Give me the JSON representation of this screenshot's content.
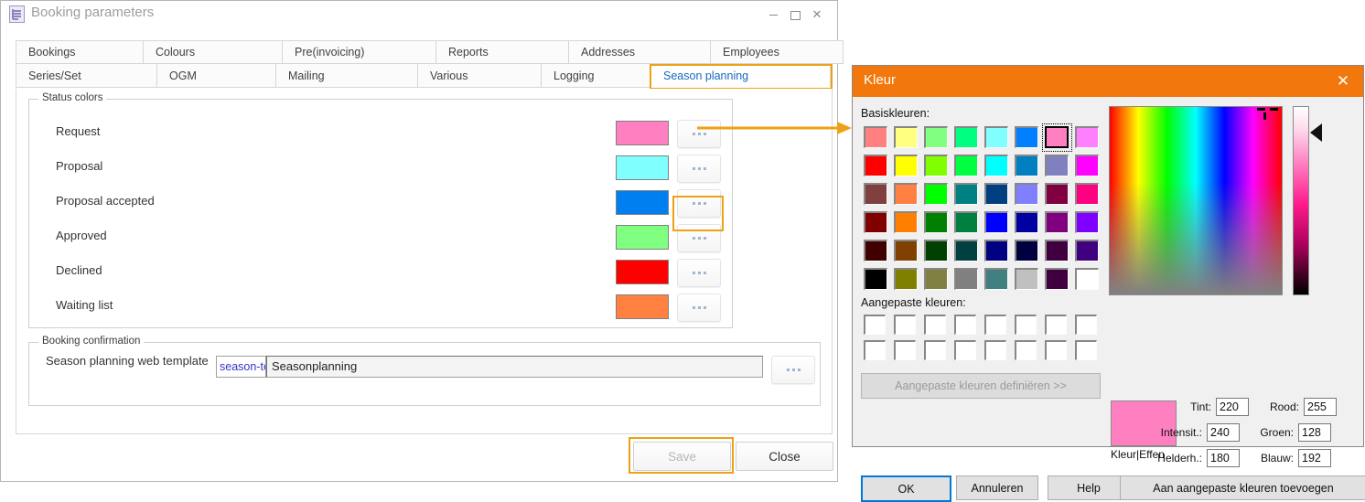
{
  "main_window": {
    "title": "Booking parameters",
    "icon": "form-icon",
    "controls": {
      "minimize": "minimize-icon",
      "maximize": "maximize-icon",
      "close": "close-icon"
    },
    "tabs_row1": [
      "Bookings",
      "Colours",
      "Pre(invoicing)",
      "Reports",
      "Addresses",
      "Employees"
    ],
    "tabs_row2": [
      "Series/Set",
      "OGM",
      "Mailing",
      "Various",
      "Logging",
      "Season planning"
    ],
    "selected_tab": "Season planning",
    "status_group": {
      "legend": "Status colors",
      "rows": [
        {
          "label": "Request",
          "color": "#FF80C0",
          "button": "..."
        },
        {
          "label": "Proposal",
          "color": "#80FFFF",
          "button": "..."
        },
        {
          "label": "Proposal accepted",
          "color": "#0080F0",
          "button": "..."
        },
        {
          "label": "Approved",
          "color": "#80FF80",
          "button": "..."
        },
        {
          "label": "Declined",
          "color": "#FF0000",
          "button": "..."
        },
        {
          "label": "Waiting list",
          "color": "#FF8040",
          "button": "..."
        }
      ]
    },
    "confirm_group": {
      "legend": "Booking confirmation",
      "field_label": "Season planning web template",
      "template_code": "season-ter",
      "template_name": "Seasonplanning",
      "browse_button": "..."
    },
    "footer": {
      "save": "Save",
      "close": "Close"
    },
    "highlight_color": "#EDA215"
  },
  "kleur_dialog": {
    "title": "Kleur",
    "close_icon": "close-icon",
    "title_bar_color": "#F2770C",
    "basic_label": "Basiskleuren:",
    "custom_label": "Aangepaste kleuren:",
    "define_button": "Aangepaste kleuren definiëren >>",
    "define_enabled": false,
    "basic_colors": [
      "#FF8080",
      "#FFFF80",
      "#80FF80",
      "#00FF80",
      "#80FFFF",
      "#0080FF",
      "#FF80C0",
      "#FF80FF",
      "#FF0000",
      "#FFFF00",
      "#80FF00",
      "#00FF40",
      "#00FFFF",
      "#0080C0",
      "#8080C0",
      "#FF00FF",
      "#804040",
      "#FF8040",
      "#00FF00",
      "#008080",
      "#004080",
      "#8080FF",
      "#800040",
      "#FF0080",
      "#800000",
      "#FF8000",
      "#008000",
      "#008040",
      "#0000FF",
      "#0000A0",
      "#800080",
      "#8000FF",
      "#400000",
      "#804000",
      "#004000",
      "#004040",
      "#000080",
      "#000040",
      "#400040",
      "#400080",
      "#000000",
      "#808000",
      "#808040",
      "#808080",
      "#408080",
      "#C0C0C0",
      "#400040",
      "#FFFFFF"
    ],
    "selected_basic_index": 6,
    "custom_colors_count": 16,
    "preview_color": "#FF80C0",
    "preview_label": "Kleur|Effen",
    "fields": [
      {
        "label": "Tint:",
        "value": "220"
      },
      {
        "label": "Intensit.:",
        "value": "240"
      },
      {
        "label": "Helderh.:",
        "value": "180"
      },
      {
        "label": "Rood:",
        "value": "255"
      },
      {
        "label": "Groen:",
        "value": "128"
      },
      {
        "label": "Blauw:",
        "value": "192"
      }
    ],
    "buttons": {
      "ok": "OK",
      "cancel": "Annuleren",
      "help": "Help",
      "add": "Aan aangepaste kleuren toevoegen"
    }
  }
}
